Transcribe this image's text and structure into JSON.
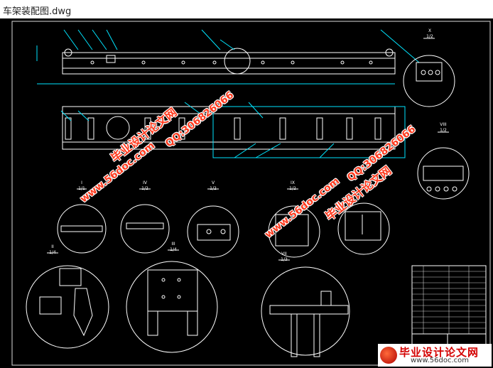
{
  "window": {
    "title": "车架装配图.dwg"
  },
  "watermarks": {
    "site_url": "www.56doc.com",
    "site_name": "毕业设计论文网",
    "qq": "QQ:306826066"
  },
  "views": [
    {
      "id": "I",
      "scale": "1/1"
    },
    {
      "id": "II",
      "scale": "1/4"
    },
    {
      "id": "III",
      "scale": "1/4"
    },
    {
      "id": "IV",
      "scale": "1/2"
    },
    {
      "id": "V",
      "scale": "1/2"
    },
    {
      "id": "VII",
      "scale": "1/3"
    },
    {
      "id": "VIII",
      "scale": "1/2"
    },
    {
      "id": "IX",
      "scale": "1/2"
    },
    {
      "id": "X",
      "scale": "1/2"
    }
  ],
  "logo": {
    "name": "毕业设计论文网",
    "url": "www.56doc.com"
  },
  "colors": {
    "drawing_bg": "#000000",
    "lines": "#ffffff",
    "accent": "#00e5ff",
    "watermark": "#ff3b1f"
  }
}
